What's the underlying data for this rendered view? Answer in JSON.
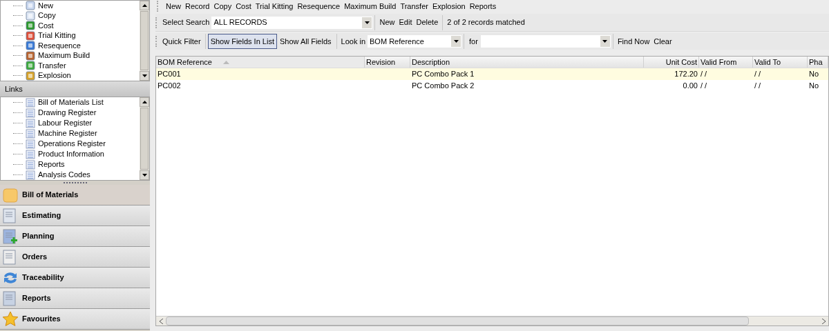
{
  "actions_tree": {
    "items": [
      "New",
      "Copy",
      "Cost",
      "Trial Kitting",
      "Resequence",
      "Maximum Build",
      "Transfer",
      "Explosion"
    ]
  },
  "links": {
    "title": "Links",
    "items": [
      "Bill of Materials List",
      "Drawing Register",
      "Labour Register",
      "Machine Register",
      "Operations Register",
      "Product Information",
      "Reports",
      "Analysis Codes"
    ]
  },
  "nav": [
    {
      "label": "Bill of Materials",
      "selected": true
    },
    {
      "label": "Estimating",
      "selected": false
    },
    {
      "label": "Planning",
      "selected": false
    },
    {
      "label": "Orders",
      "selected": false
    },
    {
      "label": "Traceability",
      "selected": false
    },
    {
      "label": "Reports",
      "selected": false
    },
    {
      "label": "Favourites",
      "selected": false
    }
  ],
  "menu_bar": [
    "New",
    "Record",
    "Copy",
    "Cost",
    "Trial Kitting",
    "Resequence",
    "Maximum Build",
    "Transfer",
    "Explosion",
    "Reports"
  ],
  "search_bar": {
    "label": "Select Search",
    "value": "ALL RECORDS",
    "actions": [
      "New",
      "Edit",
      "Delete"
    ],
    "status": "2 of 2 records matched"
  },
  "filter_bar": {
    "quick_filter": "Quick Filter",
    "toggles": [
      {
        "label": "Show Fields In List",
        "selected": true
      },
      {
        "label": "Show All Fields",
        "selected": false
      }
    ],
    "look_in_label": "Look in",
    "look_in_value": "BOM Reference",
    "for_label": "for",
    "actions": [
      "Find Now",
      "Clear"
    ]
  },
  "table": {
    "columns": [
      {
        "label": "BOM Reference",
        "sorted": true
      },
      {
        "label": "Revision",
        "sorted": false
      },
      {
        "label": "Description",
        "sorted": false
      },
      {
        "label": "Unit Cost",
        "sorted": false
      },
      {
        "label": "Valid From",
        "sorted": false
      },
      {
        "label": "Valid To",
        "sorted": false
      },
      {
        "label": "Pha",
        "sorted": false
      }
    ],
    "rows": [
      {
        "selected": true,
        "cells": [
          "PC001",
          "",
          "PC Combo Pack 1",
          "172.20",
          "/ /",
          "/ /",
          "No"
        ]
      },
      {
        "selected": false,
        "cells": [
          "PC002",
          "",
          "PC Combo Pack 2",
          "0.00",
          "/ /",
          "/ /",
          "No"
        ]
      }
    ]
  }
}
